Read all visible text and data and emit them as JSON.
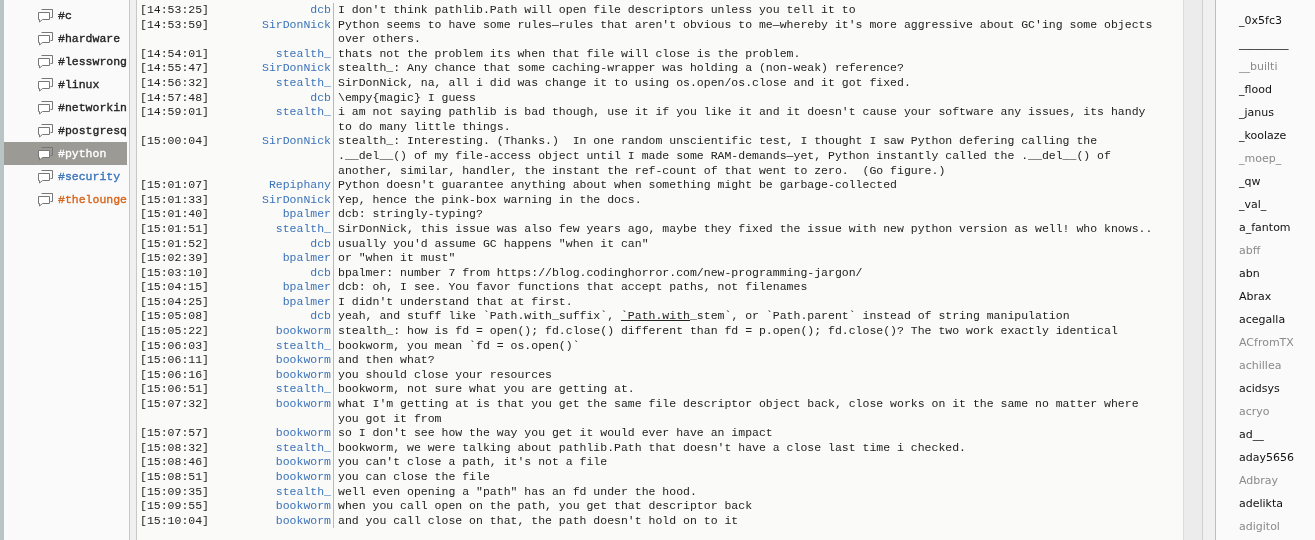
{
  "channels": [
    {
      "name": "#c",
      "selected": false,
      "color": "#222222"
    },
    {
      "name": "#hardware",
      "selected": false,
      "color": "#222222"
    },
    {
      "name": "#lesswrong",
      "selected": false,
      "color": "#222222"
    },
    {
      "name": "#linux",
      "selected": false,
      "color": "#222222"
    },
    {
      "name": "#networkin",
      "selected": false,
      "color": "#222222"
    },
    {
      "name": "#postgresq",
      "selected": false,
      "color": "#222222"
    },
    {
      "name": "#python",
      "selected": true,
      "color": "#ffffff"
    },
    {
      "name": "#security",
      "selected": false,
      "color": "#3b73b9"
    },
    {
      "name": "#thelounge",
      "selected": false,
      "color": "#d8641a"
    }
  ],
  "messages": [
    {
      "time": "[14:53:25]",
      "nick": "dcb",
      "text": "I don't think pathlib.Path will open file descriptors unless you tell it to"
    },
    {
      "time": "[14:53:59]",
      "nick": "SirDonNick",
      "text": "Python seems to have some rules—rules that aren't obvious to me—whereby it's more aggressive about GC'ing some objects over others."
    },
    {
      "time": "[14:54:01]",
      "nick": "stealth_",
      "text": "thats not the problem its when that file will close is the problem."
    },
    {
      "time": "[14:55:47]",
      "nick": "SirDonNick",
      "text": "stealth_: Any chance that some caching-wrapper was holding a (non-weak) reference?"
    },
    {
      "time": "[14:56:32]",
      "nick": "stealth_",
      "text": "SirDonNick, na, all i did was change it to using os.open/os.close and it got fixed."
    },
    {
      "time": "[14:57:48]",
      "nick": "dcb",
      "text": "\\empy{magic} I guess"
    },
    {
      "time": "[14:59:01]",
      "nick": "stealth_",
      "text": "i am not saying pathlib is bad though, use it if you like it and it doesn't cause your software any issues, its handy to do many little things."
    },
    {
      "time": "[15:00:04]",
      "nick": "SirDonNick",
      "text": "stealth_: Interesting. (Thanks.)  In one random unscientific test, I thought I saw Python defering calling the .__del__() of my file-access object until I made some RAM-demands—yet, Python instantly called the .__del__() of another, similar, handler, the instant the ref-count of that went to zero.  (Go figure.)"
    },
    {
      "time": "[15:01:07]",
      "nick": "Repiphany",
      "text": "Python doesn't guarantee anything about when something might be garbage-collected"
    },
    {
      "time": "[15:01:33]",
      "nick": "SirDonNick",
      "text": "Yep, hence the pink-box warning in the docs."
    },
    {
      "time": "[15:01:40]",
      "nick": "bpalmer",
      "text": "dcb: stringly-typing?"
    },
    {
      "time": "[15:01:51]",
      "nick": "stealth_",
      "text": "SirDonNick, this issue was also few years ago, maybe they fixed the issue with new python version as well! who knows.."
    },
    {
      "time": "[15:01:52]",
      "nick": "dcb",
      "text": "usually you'd assume GC happens \"when it can\""
    },
    {
      "time": "[15:02:39]",
      "nick": "bpalmer",
      "text": "or \"when it must\""
    },
    {
      "time": "[15:03:10]",
      "nick": "dcb",
      "text": "bpalmer: number 7 from https://blog.codinghorror.com/new-programming-jargon/"
    },
    {
      "time": "[15:04:15]",
      "nick": "bpalmer",
      "text": "dcb: oh, I see. You favor functions that accept paths, not filenames"
    },
    {
      "time": "[15:04:25]",
      "nick": "bpalmer",
      "text": "I didn't understand that at first."
    },
    {
      "time": "[15:05:08]",
      "nick": "dcb",
      "text": "yeah, and stuff like `Path.with_suffix`, ",
      "link": "`Path.with",
      "text_after": "_stem`, or `Path.parent` instead of string manipulation"
    },
    {
      "time": "[15:05:22]",
      "nick": "bookworm",
      "text": "stealth_: how is fd = open(); fd.close() different than fd = p.open(); fd.close()? The two work exactly identical"
    },
    {
      "time": "[15:06:03]",
      "nick": "stealth_",
      "text": "bookworm, you mean `fd = os.open()`"
    },
    {
      "time": "[15:06:11]",
      "nick": "bookworm",
      "text": "and then what?"
    },
    {
      "time": "[15:06:16]",
      "nick": "bookworm",
      "text": "you should close your resources"
    },
    {
      "time": "[15:06:51]",
      "nick": "stealth_",
      "text": "bookworm, not sure what you are getting at."
    },
    {
      "time": "[15:07:32]",
      "nick": "bookworm",
      "text": "what I'm getting at is that you get the same file descriptor object back, close works on it the same no matter where you got it from"
    },
    {
      "time": "[15:07:57]",
      "nick": "bookworm",
      "text": "so I don't see how the way you get it would ever have an impact"
    },
    {
      "time": "[15:08:32]",
      "nick": "stealth_",
      "text": "bookworm, we were talking about pathlib.Path that doesn't have a close last time i checked."
    },
    {
      "time": "[15:08:46]",
      "nick": "bookworm",
      "text": "you can't close a path, it's not a file"
    },
    {
      "time": "[15:08:51]",
      "nick": "bookworm",
      "text": "you can close the file"
    },
    {
      "time": "[15:09:35]",
      "nick": "stealth_",
      "text": "well even opening a \"path\" has an fd under the hood."
    },
    {
      "time": "[15:09:55]",
      "nick": "bookworm",
      "text": "when you call open on the path, you get that descriptor back"
    },
    {
      "time": "[15:10:04]",
      "nick": "bookworm",
      "text": "and you call close on that, the path doesn't hold on to it"
    }
  ],
  "users": [
    {
      "nick": "_0x5fc3",
      "away": false
    },
    {
      "nick": "_________",
      "away": false
    },
    {
      "nick": "__builti",
      "away": true
    },
    {
      "nick": "_flood",
      "away": false
    },
    {
      "nick": "_janus",
      "away": false
    },
    {
      "nick": "_koolaze",
      "away": false
    },
    {
      "nick": "_moep_",
      "away": true
    },
    {
      "nick": "_qw",
      "away": false
    },
    {
      "nick": "_val_",
      "away": false
    },
    {
      "nick": "a_fantom",
      "away": false
    },
    {
      "nick": "abff",
      "away": true
    },
    {
      "nick": "abn",
      "away": false
    },
    {
      "nick": "Abrax",
      "away": false
    },
    {
      "nick": "acegalla",
      "away": false
    },
    {
      "nick": "ACfromTX",
      "away": true
    },
    {
      "nick": "achillea",
      "away": true
    },
    {
      "nick": "acidsys",
      "away": false
    },
    {
      "nick": "acryo",
      "away": true
    },
    {
      "nick": "ad__",
      "away": false
    },
    {
      "nick": "aday5656",
      "away": false
    },
    {
      "nick": "Adbray",
      "away": true
    },
    {
      "nick": "adelikta",
      "away": false
    },
    {
      "nick": "adigitol",
      "away": true
    }
  ]
}
